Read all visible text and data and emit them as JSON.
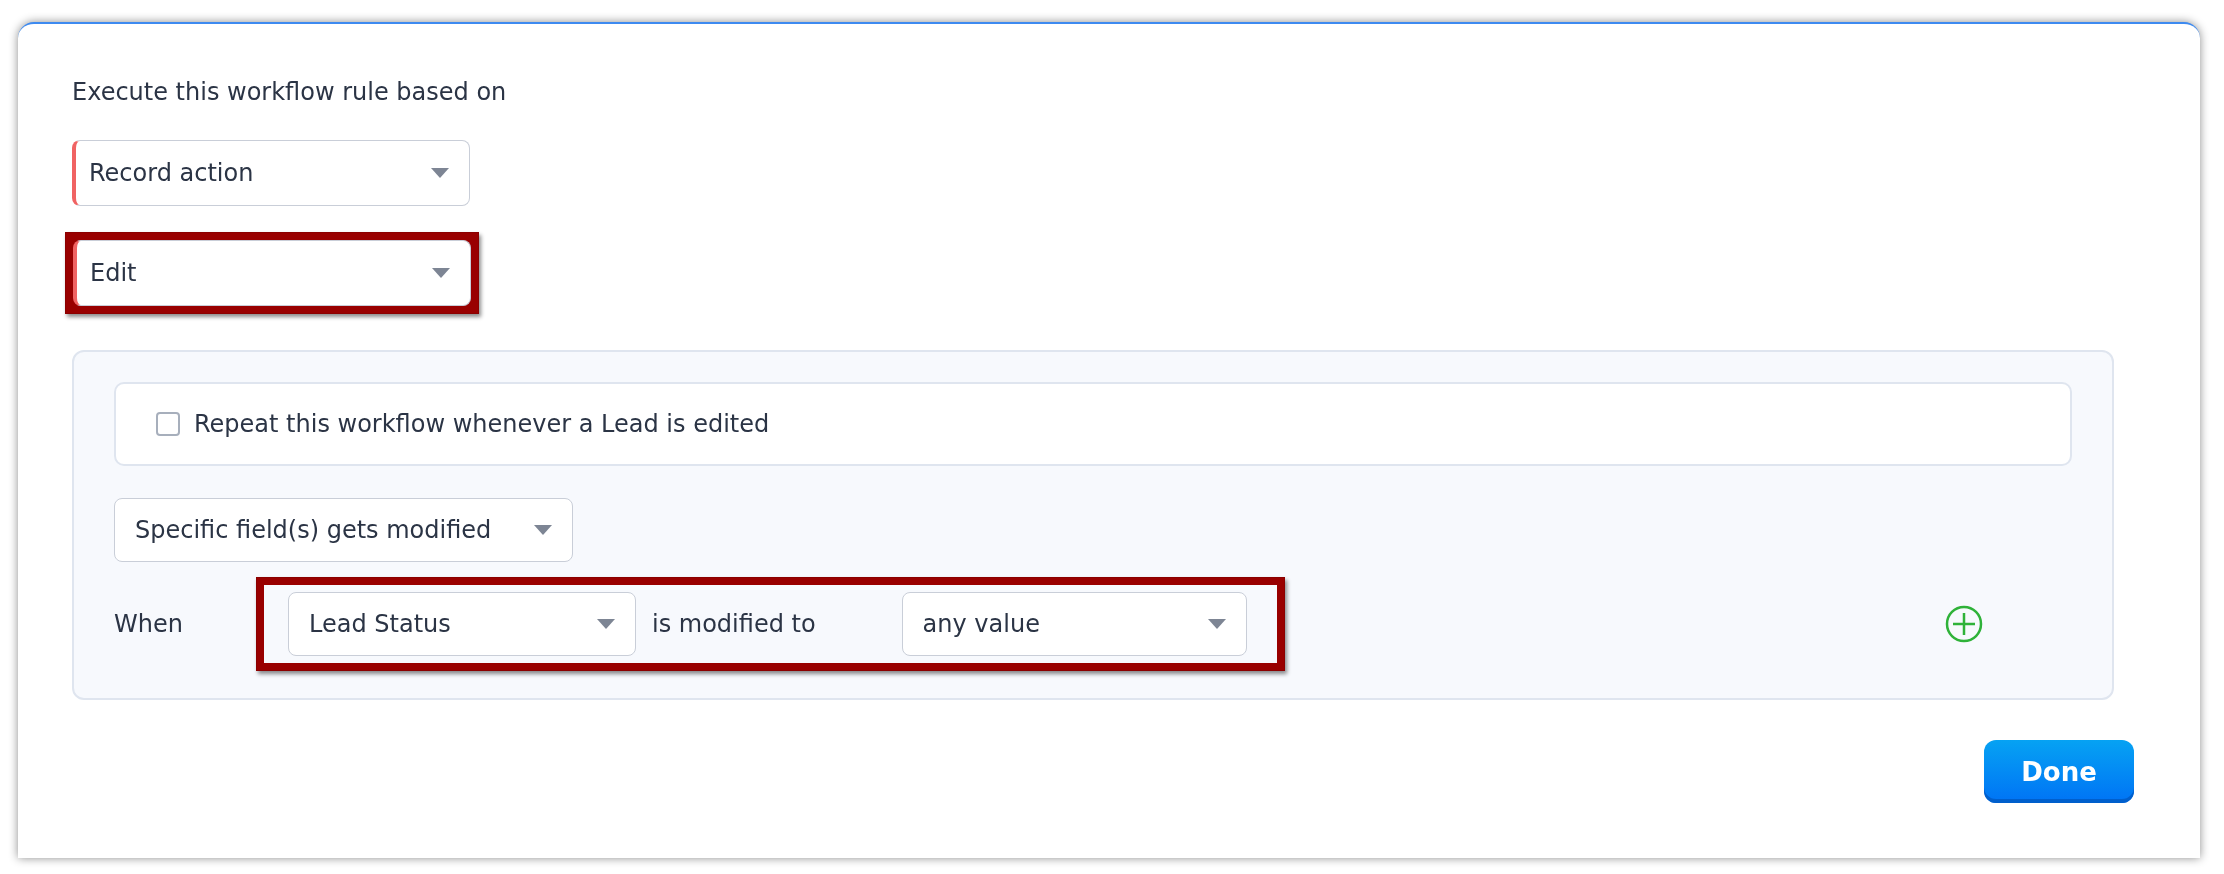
{
  "heading": "Execute this workflow rule based on",
  "trigger_dropdowns": [
    {
      "value": "Record action",
      "required": true,
      "highlighted": false
    },
    {
      "value": "Edit",
      "required": true,
      "highlighted": true
    }
  ],
  "repeat_option": {
    "label": "Repeat this workflow whenever a Lead is edited",
    "checked": false
  },
  "modification_dropdown": {
    "value": "Specific field(s) gets modified"
  },
  "condition": {
    "label": "When",
    "field": "Lead Status",
    "operator": "is modified to",
    "value": "any value",
    "highlighted": true
  },
  "done_button": "Done"
}
